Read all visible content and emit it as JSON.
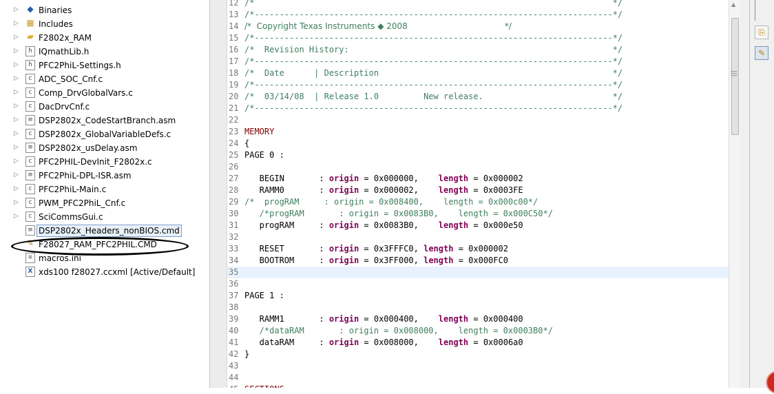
{
  "explorer": {
    "items": [
      {
        "label": "Binaries",
        "icon": "binaries-icon",
        "twisty": true
      },
      {
        "label": "Includes",
        "icon": "includes-icon",
        "twisty": true
      },
      {
        "label": "F2802x_RAM",
        "icon": "folder-icon",
        "twisty": true
      },
      {
        "label": "IQmathLib.h",
        "icon": "header-file-icon",
        "twisty": true
      },
      {
        "label": "PFC2PhiL-Settings.h",
        "icon": "header-file-icon",
        "twisty": true
      },
      {
        "label": "ADC_SOC_Cnf.c",
        "icon": "c-file-icon",
        "twisty": true
      },
      {
        "label": "Comp_DrvGlobalVars.c",
        "icon": "c-file-icon",
        "twisty": true
      },
      {
        "label": "DacDrvCnf.c",
        "icon": "c-file-icon",
        "twisty": true
      },
      {
        "label": "DSP2802x_CodeStartBranch.asm",
        "icon": "asm-file-icon",
        "twisty": true
      },
      {
        "label": "DSP2802x_GlobalVariableDefs.c",
        "icon": "c-file-icon",
        "twisty": true
      },
      {
        "label": "DSP2802x_usDelay.asm",
        "icon": "asm-file-icon",
        "twisty": true
      },
      {
        "label": "PFC2PHIL-DevInit_F2802x.c",
        "icon": "c-file-icon",
        "twisty": true
      },
      {
        "label": "PFC2PhiL-DPL-ISR.asm",
        "icon": "asm-file-icon",
        "twisty": true
      },
      {
        "label": "PFC2PhiL-Main.c",
        "icon": "c-file-icon",
        "twisty": true
      },
      {
        "label": "PWM_PFC2PhiL_Cnf.c",
        "icon": "c-file-icon",
        "twisty": true
      },
      {
        "label": "SciCommsGui.c",
        "icon": "c-file-icon",
        "twisty": true
      },
      {
        "label": "DSP2802x_Headers_nonBIOS.cmd",
        "icon": "cmd-file-icon",
        "twisty": false,
        "selected": true
      },
      {
        "label": "F28027_RAM_PFC2PHIL.CMD",
        "icon": "excluded-cmd-file-icon",
        "twisty": false
      },
      {
        "label": "macros.ini",
        "icon": "ini-file-icon",
        "twisty": false
      },
      {
        "label": "xds100 f28027.ccxml [Active/Default]",
        "icon": "ccxml-file-icon",
        "twisty": false
      }
    ]
  },
  "editor": {
    "lines": [
      {
        "n": "12",
        "t": "/*                                                                        */",
        "c": "comment"
      },
      {
        "n": "13",
        "t": "/*------------------------------------------------------------------------*/",
        "c": "comment"
      },
      {
        "n": "14",
        "t": "/*  Copyright Texas Instruments ◆ 2008                                     */",
        "c": "comment",
        "prop": true
      },
      {
        "n": "15",
        "t": "/*------------------------------------------------------------------------*/",
        "c": "comment"
      },
      {
        "n": "16",
        "t": "/*  Revision History:                                                     */",
        "c": "comment"
      },
      {
        "n": "17",
        "t": "/*------------------------------------------------------------------------*/",
        "c": "comment"
      },
      {
        "n": "18",
        "t": "/*  Date      | Description                                               */",
        "c": "comment"
      },
      {
        "n": "19",
        "t": "/*------------------------------------------------------------------------*/",
        "c": "comment"
      },
      {
        "n": "20",
        "t": "/*  03/14/08  | Release 1.0         New release.                          */",
        "c": "comment"
      },
      {
        "n": "21",
        "t": "/*------------------------------------------------------------------------*/",
        "c": "comment"
      },
      {
        "n": "22",
        "t": "",
        "c": "plain"
      },
      {
        "n": "23",
        "t": "MEMORY",
        "c": "dk"
      },
      {
        "n": "24",
        "t": "{",
        "c": "plain"
      },
      {
        "n": "25",
        "t": "PAGE 0 :",
        "c": "plain"
      },
      {
        "n": "26",
        "t": "",
        "c": "plain"
      },
      {
        "n": "27",
        "t": "   BEGIN       : origin = 0x000000,    length = 0x000002",
        "c": "mem"
      },
      {
        "n": "28",
        "t": "   RAMM0       : origin = 0x000002,    length = 0x0003FE",
        "c": "mem"
      },
      {
        "n": "29",
        "t": "/*  progRAM     : origin = 0x008400,    length = 0x000c00*/",
        "c": "comment"
      },
      {
        "n": "30",
        "t": "   /*progRAM       : origin = 0x0083B0,    length = 0x000C50*/",
        "c": "comment"
      },
      {
        "n": "31",
        "t": "   progRAM     : origin = 0x0083B0,    length = 0x000e50",
        "c": "mem"
      },
      {
        "n": "32",
        "t": "",
        "c": "plain"
      },
      {
        "n": "33",
        "t": "   RESET       : origin = 0x3FFFC0, length = 0x000002",
        "c": "mem"
      },
      {
        "n": "34",
        "t": "   BOOTROM     : origin = 0x3FF000, length = 0x000FC0",
        "c": "mem"
      },
      {
        "n": "35",
        "t": "",
        "c": "plain",
        "highlight": true
      },
      {
        "n": "36",
        "t": "",
        "c": "plain"
      },
      {
        "n": "37",
        "t": "PAGE 1 :",
        "c": "plain"
      },
      {
        "n": "38",
        "t": "",
        "c": "plain"
      },
      {
        "n": "39",
        "t": "   RAMM1       : origin = 0x000400,    length = 0x000400",
        "c": "mem"
      },
      {
        "n": "40",
        "t": "   /*dataRAM       : origin = 0x008000,    length = 0x0003B0*/",
        "c": "comment"
      },
      {
        "n": "41",
        "t": "   dataRAM     : origin = 0x008000,    length = 0x0006a0",
        "c": "mem"
      },
      {
        "n": "42",
        "t": "}",
        "c": "plain"
      },
      {
        "n": "43",
        "t": "",
        "c": "plain"
      },
      {
        "n": "44",
        "t": "",
        "c": "plain"
      },
      {
        "n": "45",
        "t": "SECTIONS",
        "c": "dk"
      }
    ]
  },
  "colors": {
    "comment": "#3f7f5f",
    "keyword": "#7f0055",
    "line_highlight": "#e8f2fe",
    "selection": "#e8f0fb"
  }
}
